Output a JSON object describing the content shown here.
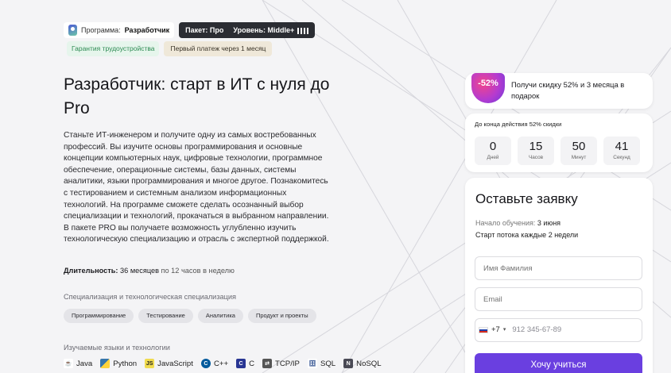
{
  "program_badge": {
    "prefix": "Программа:",
    "name": "Разработчик"
  },
  "package_badge": {
    "package": "Пакет: Про",
    "level": "Уровень: Middle+"
  },
  "guarantee": "Гарантия трудоустройства",
  "first_payment": "Первый платеж через 1 месяц",
  "title": "Разработчик: старт в ИТ с нуля до Pro",
  "description": "Станьте ИТ-инженером и получите одну из самых востребованных профессий. Вы изучите основы программирования и основные концепции компьютерных наук, цифровые технологии, программное обеспечение, операционные системы, базы данных, системы аналитики, языки программирования и многое другое. Познакомитесь с тестированием и системным анализом информационных технологий. На программе сможете сделать осознанный выбор специализации и технологий, прокачаться в выбранном направлении. В пакете PRO вы получаете возможность углубленно изучить технологическую специализацию и отрасль с экспертной поддержкой.",
  "duration": {
    "label": "Длительность:",
    "value": "36 месяцев",
    "note": "по 12 часов в неделю"
  },
  "specialization": {
    "label": "Специализация и технологическая специализация",
    "chips": [
      "Программирование",
      "Тестирование",
      "Аналитика",
      "Продукт и проекты"
    ]
  },
  "technologies": {
    "label": "Изучаемые языки и технологии",
    "items": [
      {
        "name": "Java",
        "icon": "java-icon"
      },
      {
        "name": "Python",
        "icon": "python-icon"
      },
      {
        "name": "JavaScript",
        "icon": "javascript-icon"
      },
      {
        "name": "C++",
        "icon": "cpp-icon"
      },
      {
        "name": "C",
        "icon": "c-icon"
      },
      {
        "name": "TCP/IP",
        "icon": "network-icon"
      },
      {
        "name": "SQL",
        "icon": "database-icon"
      },
      {
        "name": "NoSQL",
        "icon": "nosql-icon"
      }
    ]
  },
  "promo": {
    "badge": "-52%",
    "text": "Получи скидку 52% и 3 месяца в подарок"
  },
  "timer": {
    "title": "До конца действия 52% скидки",
    "units": [
      {
        "value": "0",
        "label": "Дней"
      },
      {
        "value": "15",
        "label": "Часов"
      },
      {
        "value": "50",
        "label": "Минут"
      },
      {
        "value": "41",
        "label": "Секунд"
      }
    ]
  },
  "form": {
    "title": "Оставьте заявку",
    "start_label": "Начало обучения:",
    "start_value": "3 июня",
    "stream": "Старт потока каждые 2 недели",
    "name_placeholder": "Имя Фамилия",
    "email_placeholder": "Email",
    "phone_code": "+7",
    "phone_placeholder": "912 345-67-89",
    "submit_label": "Хочу учиться"
  },
  "colors": {
    "accent": "#6a3fe0",
    "green": "#2c8a52",
    "dark_badge": "#2b2d33",
    "promo_pink": "#f2458b"
  }
}
